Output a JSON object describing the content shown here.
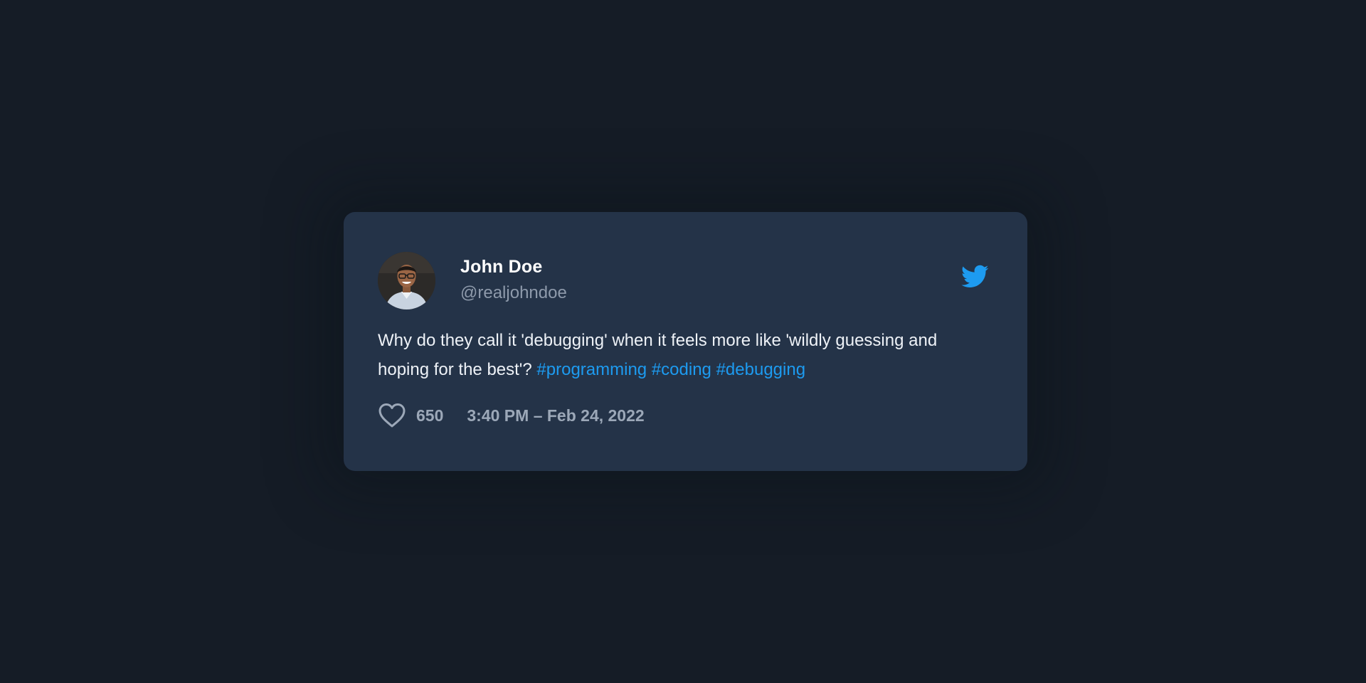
{
  "tweet": {
    "author_name": "John Doe",
    "handle": "@realjohndoe",
    "text": "Why do they call it 'debugging' when it feels more like 'wildly guessing and hoping for the best'?",
    "hashtags": [
      "#programming",
      "#coding",
      "#debugging"
    ],
    "likes": "650",
    "timestamp": "3:40 PM – Feb 24, 2022"
  },
  "icons": {
    "brand": "twitter-bird-icon",
    "like": "heart-outline-icon"
  },
  "colors": {
    "background": "#151c26",
    "card": "#243348",
    "accent": "#1d9bf0",
    "muted": "#9ca8b8",
    "text": "#eef2f7"
  }
}
